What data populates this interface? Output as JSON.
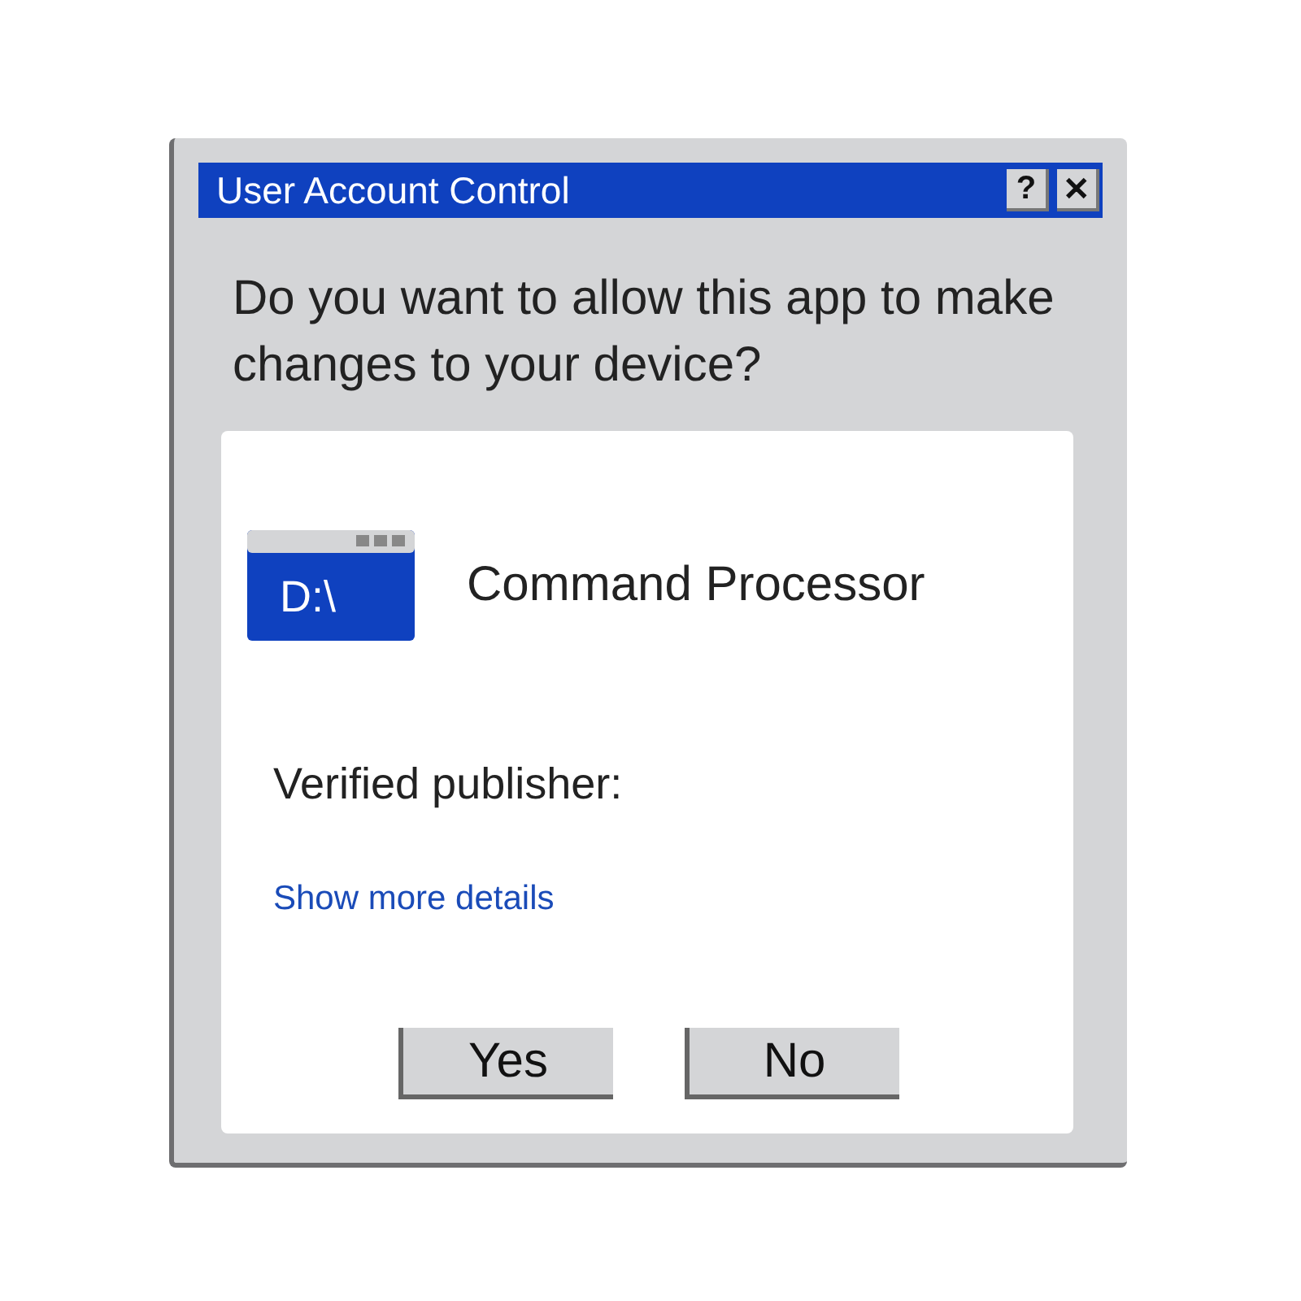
{
  "window": {
    "title": "User Account Control",
    "title_buttons": [
      "?",
      "✕"
    ]
  },
  "question": "Do you want to allow this app to make changes to your device?",
  "app": {
    "icon_text": "D:\\",
    "name": "Command Processor"
  },
  "publisher_label": "Verified publisher:",
  "details_link": "Show more details",
  "buttons": [
    "Yes",
    "No"
  ]
}
